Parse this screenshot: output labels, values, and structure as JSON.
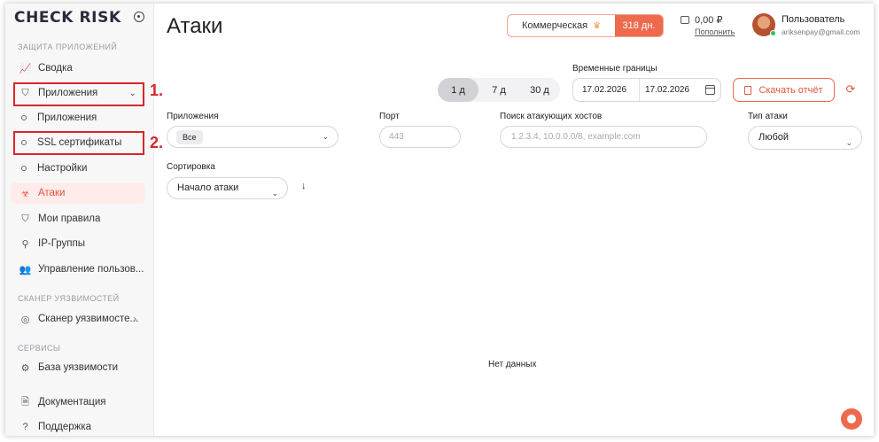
{
  "brand": {
    "logo": "CHECK RISK"
  },
  "sidebar": {
    "sections": {
      "apps": "ЗАЩИТА ПРИЛОЖЕНИЙ",
      "scanner": "СКАНЕР УЯЗВИМОСТЕЙ",
      "services": "СЕРВИСЫ"
    },
    "items": {
      "summary": "Сводка",
      "applications": "Приложения",
      "apps_sub": "Приложения",
      "ssl": "SSL сертификаты",
      "settings": "Настройки",
      "attacks": "Атаки",
      "rules": "Мои правила",
      "ip_groups": "IP-Группы",
      "users": "Управление пользов...",
      "scanner": "Сканер уязвимосте...",
      "vuln_db": "База уязвимости",
      "docs": "Документация",
      "support": "Поддержка"
    },
    "annotations": {
      "one": "1.",
      "two": "2."
    }
  },
  "header": {
    "title": "Атаки",
    "plan": "Коммерческая",
    "plan_days": "318 дн.",
    "balance": "0,00 ₽",
    "topup": "Пополнить",
    "user_name": "Пользователь",
    "user_email": "ariksenpay@gmail.com"
  },
  "filters": {
    "range_title": "Временные границы",
    "periods": [
      "1 д",
      "7 д",
      "30 д"
    ],
    "date_from": "17.02.2026",
    "date_to": "17.02.2026",
    "report": "Скачать отчёт",
    "apps_label": "Приложения",
    "apps_value": "Все",
    "port_label": "Порт",
    "port_placeholder": "443",
    "hosts_label": "Поиск атакующих хостов",
    "hosts_placeholder": "1.2.3.4, 10.0.0.0/8, example.com",
    "type_label": "Тип атаки",
    "type_value": "Любой",
    "sort_label": "Сортировка",
    "sort_value": "Начало атаки"
  },
  "content": {
    "empty": "Нет данных"
  },
  "colors": {
    "accent": "#ee6a4d",
    "annotation": "#d8262a"
  }
}
